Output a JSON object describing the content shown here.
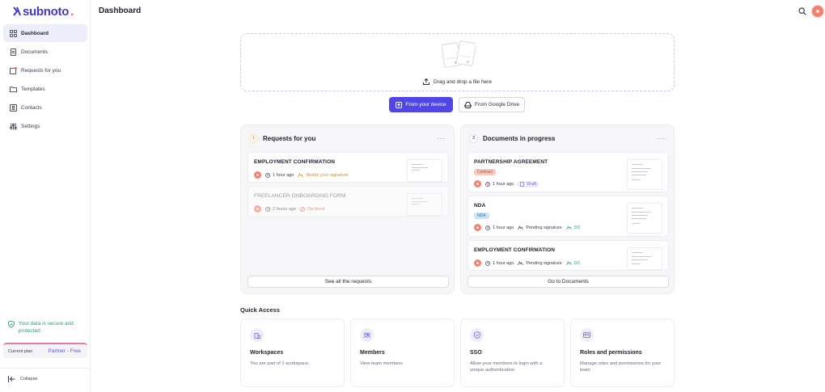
{
  "app": {
    "logo_text": "subnoto",
    "logo_dot": "."
  },
  "header": {
    "title": "Dashboard"
  },
  "sidebar": {
    "items": [
      {
        "label": "Dashboard",
        "icon": "grid-icon",
        "active": true
      },
      {
        "label": "Documents",
        "icon": "document-icon"
      },
      {
        "label": "Requests for you",
        "icon": "inbox-icon"
      },
      {
        "label": "Templates",
        "icon": "folder-icon"
      },
      {
        "label": "Contacts",
        "icon": "contact-card-icon"
      },
      {
        "label": "Settings",
        "icon": "sliders-icon"
      }
    ],
    "secure_text": "Your data is secure and protected",
    "plan_label": "Current plan",
    "plan_value": "Partner - Free",
    "collapse_label": "Collapse"
  },
  "upload": {
    "drop_label": "Drag and drop a file here",
    "device_button": "From your device",
    "drive_button": "From Google Drive"
  },
  "requests": {
    "count": "1",
    "title": "Requests for you",
    "items": [
      {
        "title": "EMPLOYMENT CONFIRMATION",
        "time": "1 hour ago",
        "status": "Needs your signature"
      },
      {
        "title": "FREELANCER ONBOARDING FORM",
        "time": "2 hours ago",
        "status": "Declined"
      }
    ],
    "button": "See all the requests"
  },
  "documents": {
    "count": "3",
    "title": "Documents in progress",
    "items": [
      {
        "title": "PARTNERSHIP AGREEMENT",
        "tag": "Contract",
        "time": "1 hour ago",
        "status": "Draft"
      },
      {
        "title": "NDA",
        "tag": "NDA",
        "time": "1 hour ago",
        "status": "Pending signature",
        "progress": "0/2"
      },
      {
        "title": "EMPLOYMENT CONFIRMATION",
        "time": "1 hour ago",
        "status": "Pending signature",
        "progress": "0/1"
      }
    ],
    "button": "Go to Documents"
  },
  "quick_access": {
    "title": "Quick Access",
    "cards": [
      {
        "name": "Workspaces",
        "desc": "You are part of 1 workspace.",
        "icon": "building-icon"
      },
      {
        "name": "Members",
        "desc": "View team members",
        "icon": "users-icon"
      },
      {
        "name": "SSO",
        "desc": "Allow your members to login with a unique authentication",
        "icon": "shield-icon"
      },
      {
        "name": "Roles and permissions",
        "desc": "Manage roles and permissions for your team",
        "icon": "id-card-icon"
      }
    ]
  },
  "colors": {
    "accent": "#4f46e5",
    "brand": "#4338ca",
    "brand_dot": "#ef5a45",
    "secure": "#22a06b",
    "warning": "#e08a16",
    "declined": "#e25c48"
  }
}
